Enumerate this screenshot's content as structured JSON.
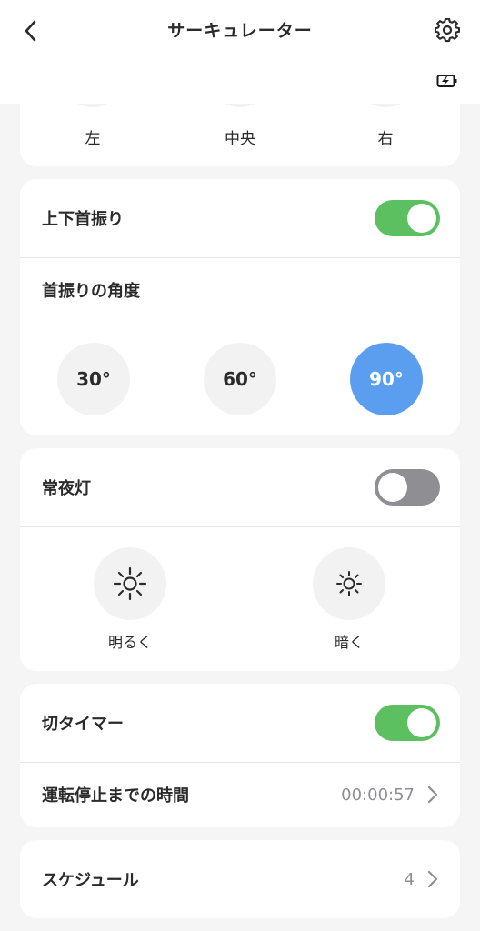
{
  "header": {
    "title": "サーキュレーター",
    "back_icon": "chevron-left-icon",
    "settings_icon": "gear-icon",
    "battery_icon": "battery-charging-icon"
  },
  "direction": {
    "items": [
      {
        "label": "左"
      },
      {
        "label": "中央"
      },
      {
        "label": "右"
      }
    ]
  },
  "oscillation": {
    "label": "上下首振り",
    "enabled": true,
    "angle_label": "首振りの角度",
    "angles": [
      {
        "label": "30°",
        "selected": false
      },
      {
        "label": "60°",
        "selected": false
      },
      {
        "label": "90°",
        "selected": true
      }
    ]
  },
  "night_light": {
    "label": "常夜灯",
    "enabled": false,
    "options": [
      {
        "label": "明るく",
        "icon": "sun-bright-icon"
      },
      {
        "label": "暗く",
        "icon": "sun-dim-icon"
      }
    ]
  },
  "off_timer": {
    "label": "切タイマー",
    "enabled": true,
    "remaining_label": "運転停止までの時間",
    "remaining_value": "00:00:57"
  },
  "schedule": {
    "label": "スケジュール",
    "count": "4"
  },
  "colors": {
    "toggle_on": "#5cc060",
    "toggle_off": "#8e8e93",
    "accent_selected": "#5b9ef0",
    "background": "#f5f5f5"
  }
}
